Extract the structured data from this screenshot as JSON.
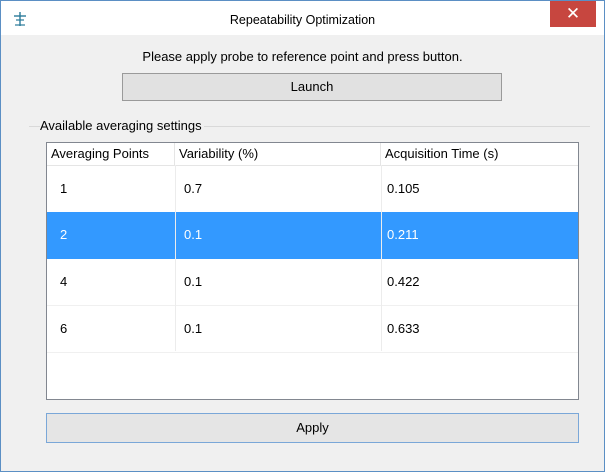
{
  "window": {
    "title": "Repeatability Optimization",
    "close_label": "✕",
    "app_icon": "probe-icon"
  },
  "instruction": "Please apply probe to reference point and press button.",
  "launch_label": "Launch",
  "group_label": "Available averaging settings",
  "table": {
    "headers": [
      "Averaging Points",
      "Variability (%)",
      "Acquisition Time (s)"
    ],
    "rows": [
      [
        "1",
        "0.7",
        "0.105"
      ],
      [
        "2",
        "0.1",
        "0.211"
      ],
      [
        "4",
        "0.1",
        "0.422"
      ],
      [
        "6",
        "0.1",
        "0.633"
      ]
    ],
    "selected_row": 1,
    "selection_color": "#3399ff"
  },
  "apply_label": "Apply"
}
